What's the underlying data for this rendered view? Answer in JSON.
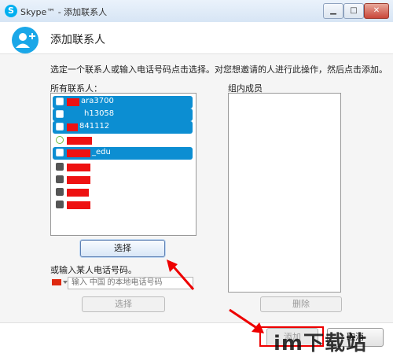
{
  "window": {
    "title": "Skype™ - 添加联系人",
    "app_icon_letter": "S",
    "min_glyph": "▁",
    "max_glyph": "□",
    "close_glyph": "✕"
  },
  "header": {
    "title": "添加联系人"
  },
  "instruction": "选定一个联系人或输入电话号码点击选择。对您想邀请的人进行此操作，然后点击添加。",
  "contacts": {
    "label": "所有联系人：",
    "items": [
      {
        "name": "ara3700",
        "state": "selected"
      },
      {
        "name": "h13058",
        "state": "selected"
      },
      {
        "name": "841112",
        "state": "selected"
      },
      {
        "name": "",
        "state": "online"
      },
      {
        "name": "_edu",
        "state": "selected"
      },
      {
        "name": "",
        "state": "offline"
      },
      {
        "name": "",
        "state": "offline"
      },
      {
        "name": "",
        "state": "offline"
      },
      {
        "name": "",
        "state": "offline"
      }
    ],
    "select_button": "选择"
  },
  "phone": {
    "label": "或输入某人电话号码。",
    "placeholder": "输入 中国 的本地电话号码",
    "select_button": "选择"
  },
  "group": {
    "label": "组内成员",
    "remove_button": "删除"
  },
  "footer": {
    "add_button": "添加",
    "cancel_button": "取消"
  },
  "watermark": "im下载站",
  "colors": {
    "accent": "#0c8ed2",
    "redaction": "#e11111",
    "annotation": "#e00000"
  }
}
